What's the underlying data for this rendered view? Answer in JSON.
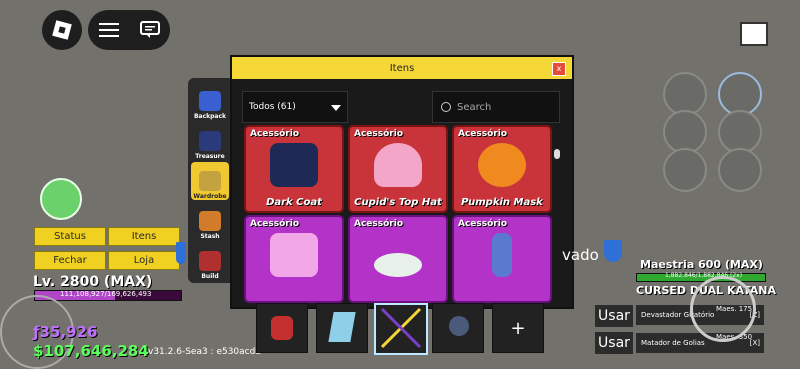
{
  "window": {
    "title": "Itens",
    "close_label": "x"
  },
  "filter": {
    "value": "Todos (61)"
  },
  "search": {
    "placeholder": "Search"
  },
  "sidebar": {
    "items": [
      {
        "label": "Backpack",
        "icon": "backpack-icon",
        "color": "#3a5fd0"
      },
      {
        "label": "Treasure",
        "icon": "treasure-icon",
        "color": "#2b3a7a"
      },
      {
        "label": "Wardrobe",
        "icon": "wardrobe-icon",
        "color": "#c4a240",
        "active": true
      },
      {
        "label": "Stash",
        "icon": "stash-icon",
        "color": "#d07c2a"
      },
      {
        "label": "Build",
        "icon": "build-icon",
        "color": "#b03030"
      }
    ]
  },
  "items": [
    {
      "tag": "Acessório",
      "name": "Dark Coat",
      "rarity": "red",
      "art_color": "#1e2a55"
    },
    {
      "tag": "Acessório",
      "name": "Cupid's Top Hat",
      "rarity": "red",
      "art_color": "#f4a6c8"
    },
    {
      "tag": "Acessório",
      "name": "Pumpkin Mask",
      "rarity": "red",
      "art_color": "#f08a1e"
    },
    {
      "tag": "Acessório",
      "name": "",
      "rarity": "purple",
      "art_color": "#f2a8e8"
    },
    {
      "tag": "Acessório",
      "name": "",
      "rarity": "purple",
      "art_color": "#e8f0ea"
    },
    {
      "tag": "Acessório",
      "name": "",
      "rarity": "purple",
      "art_color": "#5a7ad0"
    }
  ],
  "menu": {
    "status": "Status",
    "itens": "Itens",
    "fechar": "Fechar",
    "loja": "Loja"
  },
  "player": {
    "level": "Lv. 2800 (MAX)",
    "xp": "111,108,927/169,626,493",
    "fragments": "ƒ35,926",
    "money": "$107,646,284"
  },
  "version": "v31.2.6-Sea3 : e530acda",
  "background_text": {
    "vado": "vado"
  },
  "weapon": {
    "mastery": "Maestria 600 (MAX)",
    "mastery_xp": "1,882,846/1,882,846 (2x)",
    "name": "CURSED DUAL KATANA",
    "moves": [
      {
        "name": "Devastador Giratório",
        "info": "Maes. 175",
        "key": "[Z]"
      },
      {
        "name": "Matador de Golias",
        "info": "Maes. 350",
        "key": "[X]"
      }
    ]
  },
  "actions": {
    "usar1": "Usar",
    "usar2": "Usar"
  },
  "hotbar": {
    "add_label": "+"
  },
  "colors": {
    "accent": "#f5d836",
    "panel": "#1a1a1a",
    "bg": "#73716b"
  }
}
